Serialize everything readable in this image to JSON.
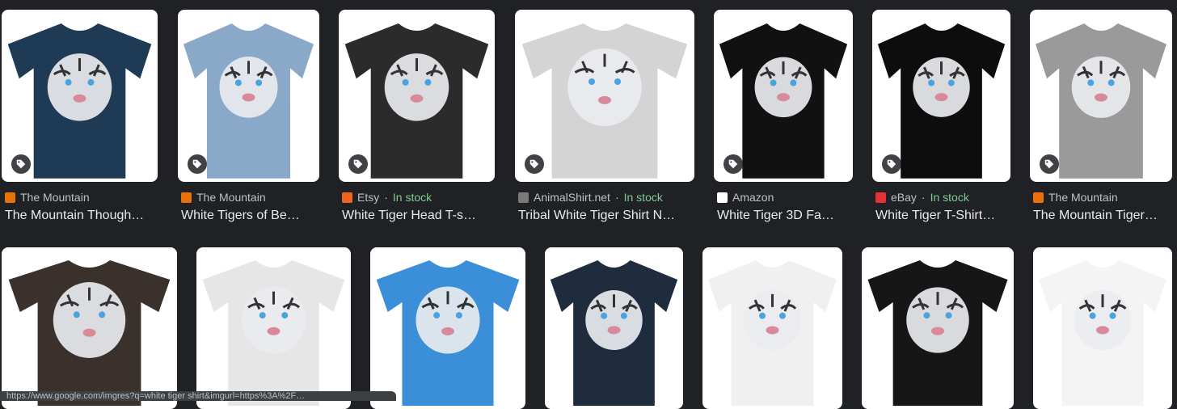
{
  "colors": {
    "bg": "#202124",
    "title": "#e8eaed",
    "source": "#bdc1c6",
    "in_stock": "#81c995"
  },
  "row1": [
    {
      "source": "The Mountain",
      "stock": "",
      "title": "The Mountain Though…",
      "favicon_color": "#e8710a",
      "shirt": "#1f3a55"
    },
    {
      "source": "The Mountain",
      "stock": "",
      "title": "White Tigers of Be…",
      "favicon_color": "#e8710a",
      "shirt": "#8aa8c8"
    },
    {
      "source": "Etsy",
      "stock": "In stock",
      "title": "White Tiger Head T-s…",
      "favicon_color": "#f1641e",
      "shirt": "#2b2b2b"
    },
    {
      "source": "AnimalShirt.net",
      "stock": "In stock",
      "title": "Tribal White Tiger Shirt N…",
      "favicon_color": "#7a7a7a",
      "shirt": "#d4d4d4"
    },
    {
      "source": "Amazon",
      "stock": "",
      "title": "White Tiger 3D Fa…",
      "favicon_color": "#ffffff",
      "shirt": "#111111"
    },
    {
      "source": "eBay",
      "stock": "In stock",
      "title": "White Tiger T-Shirt…",
      "favicon_color": "#e53238",
      "shirt": "#0d0d0d"
    },
    {
      "source": "The Mountain",
      "stock": "",
      "title": "The Mountain Tiger…",
      "favicon_color": "#e8710a",
      "shirt": "#9a9a9a"
    }
  ],
  "row2": [
    {
      "shirt": "#3a302c"
    },
    {
      "shirt": "#e6e6e6"
    },
    {
      "shirt": "#3b8fd9"
    },
    {
      "shirt": "#1e2c3e"
    },
    {
      "shirt": "#f0f0f0"
    },
    {
      "shirt": "#161616"
    },
    {
      "shirt": "#f4f4f4"
    }
  ],
  "status_bar": {
    "url": "https://www.google.com/imgres?q=white tiger shirt&imgurl=https%3A%2F…"
  }
}
